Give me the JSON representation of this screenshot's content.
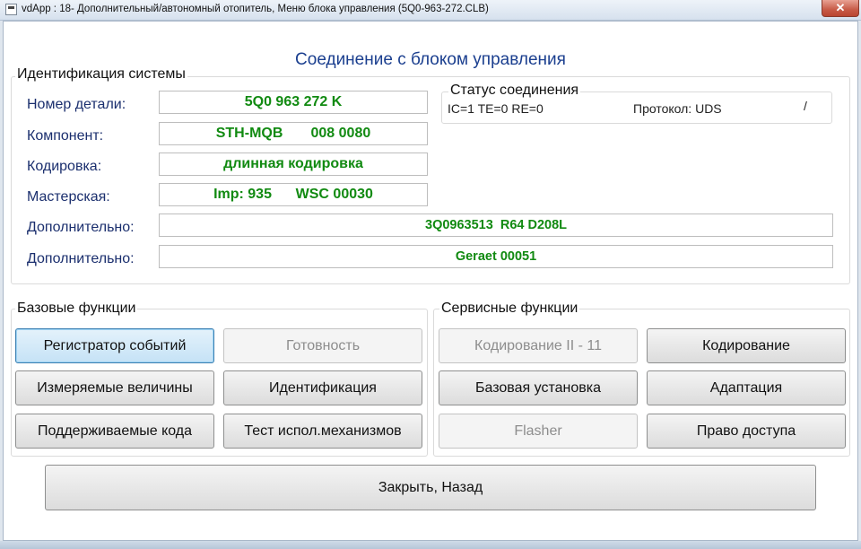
{
  "window": {
    "title": "vdApp : 18- Дополнительный/автономный отопитель,  Меню блока управления (5Q0-963-272.CLB)",
    "close_label": "✕"
  },
  "main_title": "Соединение с блоком управления",
  "identification": {
    "group_label": "Идентификация системы",
    "fields": [
      {
        "label": "Номер детали:",
        "value": "5Q0 963 272 K"
      },
      {
        "label": "Компонент:",
        "value": "STH-MQB       008 0080"
      },
      {
        "label": "Кодировка:",
        "value": "длинная кодировка"
      },
      {
        "label": "Мастерская:",
        "value": "Imp: 935      WSC 00030"
      },
      {
        "label": "Дополнительно:",
        "value": "3Q0963513  R64 D208L"
      },
      {
        "label": "Дополнительно:",
        "value": "Geraet 00051"
      }
    ]
  },
  "connection_status": {
    "group_label": "Статус соединения",
    "counters": "IC=1  TE=0   RE=0",
    "protocol": "Протокол: UDS",
    "extra": "/"
  },
  "basic_functions": {
    "group_label": "Базовые функции",
    "buttons": [
      {
        "label": "Регистратор событий",
        "enabled": true
      },
      {
        "label": "Готовность",
        "enabled": false
      },
      {
        "label": "Измеряемые величины",
        "enabled": true
      },
      {
        "label": "Идентификация",
        "enabled": true
      },
      {
        "label": "Поддерживаемые кода",
        "enabled": true
      },
      {
        "label": "Тест испол.механизмов",
        "enabled": true
      }
    ]
  },
  "service_functions": {
    "group_label": "Сервисные функции",
    "buttons": [
      {
        "label": "Кодирование II - 11",
        "enabled": false
      },
      {
        "label": "Кодирование",
        "enabled": true
      },
      {
        "label": "Базовая установка",
        "enabled": true
      },
      {
        "label": "Адаптация",
        "enabled": true
      },
      {
        "label": "Flasher",
        "enabled": false
      },
      {
        "label": "Право доступа",
        "enabled": true
      }
    ]
  },
  "close_button_label": "Закрыть, Назад",
  "colors": {
    "title_blue": "#1b3f8f",
    "value_green": "#118a11",
    "label_blue": "#1b2f6e",
    "focus_blue": "#3c7fb1"
  }
}
